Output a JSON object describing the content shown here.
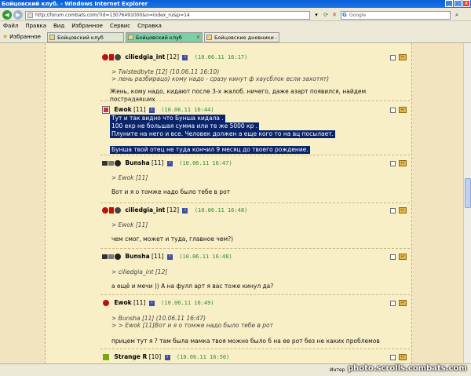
{
  "window": {
    "title": "Бойцовский клуб. - Windows Internet Explorer",
    "url": "http://forum.combats.com/?id=13076491000&n=index_ru&p=14",
    "search_placeholder": "Google"
  },
  "menu": [
    "Файл",
    "Правка",
    "Вид",
    "Избранное",
    "Сервис",
    "Справка"
  ],
  "favorites": {
    "label": "Избранное",
    "tabs": [
      {
        "label": "Бойцовский клуб",
        "active": false
      },
      {
        "label": "Бойцовский клуб",
        "active": true
      },
      {
        "label": "Бойцовские дневники - Bu...",
        "active": false
      }
    ]
  },
  "posts": [
    {
      "nick": "ciliedgia_int",
      "level": "[12]",
      "date": "(10.06.11 16:17)",
      "quote": [
        "> Twistedbyte [12] (10.06.11 16:10)",
        "> лень разбирацо) кому надо - сразу кинут ф хаусблок если захотят)"
      ],
      "body": [
        "Жень, кому надо, кидают после 3-х жалоб. ничего, даже азарт появился, найдем пострадавших."
      ]
    },
    {
      "nick": "Ewok",
      "level": "[11]",
      "date": "(10.06.11 16:44)",
      "body_selected": [
        "Тут и так видно что Бунша кидала .",
        "100 екр не большая сумма или те же 5000 кр .",
        "Плуните на него и все. Человек должен а еще кого то на вц посылает.",
        "",
        "Бунша твой отец не туда кончил 9 месяц до твоего рождение."
      ]
    },
    {
      "nick": "Bunsha",
      "level": "[11]",
      "date": "(10.06.11 16:47)",
      "quote": [
        "> Ewok [11]"
      ],
      "body": [
        "Вот и я о томже надо было тебе в рот"
      ]
    },
    {
      "nick": "ciliedgia_int",
      "level": "[12]",
      "date": "(10.06.11 16:48)",
      "quote": [
        "> Ewok [11]"
      ],
      "body": [
        "чем смог, может и туда, главное чем?)"
      ]
    },
    {
      "nick": "Bunsha",
      "level": "[11]",
      "date": "(10.06.11 16:48)",
      "quote": [
        "> ciliedgia_int [12]"
      ],
      "body": [
        "а ещё и мечи )) А на фулл арт я вас тоже кинул да?"
      ]
    },
    {
      "nick": "Ewok",
      "level": "[11]",
      "date": "(10.06.11 16:49)",
      "quote": [
        "> Bunsha [11] (10.06.11 16:47)",
        "> > Ewok [11]Вот и я о томже надо было тебе в рот"
      ],
      "body": [
        "прицем тут я ? там была мамка твоя можно было б на ее рот без не каких проблемов"
      ]
    },
    {
      "nick": "Strange R",
      "level": "[10]",
      "date": "(10.06.11 16:50)"
    }
  ],
  "status": {
    "zone": "Интер",
    "watermark": "photo.scrolls.combats.com"
  },
  "colors": {
    "page_bg": "#f1e4bf",
    "panel_bg": "#f9efc6",
    "date": "#2d8c2d",
    "selection": "#0a246a"
  }
}
